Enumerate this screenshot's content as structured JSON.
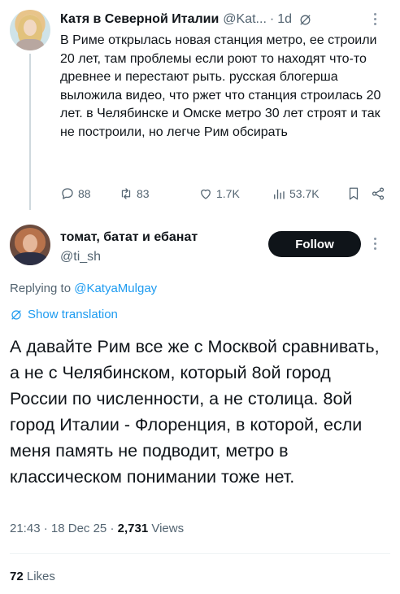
{
  "parent_tweet": {
    "author_name": "Катя в Северной Италии",
    "author_handle": "@Kat...",
    "separator": "·",
    "time": "1d",
    "text": "В Риме открылась новая станция метро, ее строили 20 лет, там проблемы если роют то находят что-то древнее и перестают рыть. русская блогерша выложила видео, что ржет что станция строилась 20 лет. в Челябинске и Омске метро 30 лет строят и так не построили, но легче Рим обсирать",
    "replies": "88",
    "retweets": "83",
    "likes": "1.7K",
    "views": "53.7K"
  },
  "main_tweet": {
    "author_name": "томат, батат и ебанат",
    "author_handle": "@ti_sh",
    "follow_label": "Follow",
    "replying_prefix": "Replying to",
    "replying_mention": "@KatyaMulgay",
    "translate_label": "Show translation",
    "text": "А давайте Рим все же с Москвой сравнивать, а не с Челябинском, который 8ой город России по численности, а не столица. 8ой город Италии - Флоренция, в которой, если меня память не подводит, метро в классическом понимании тоже нет.",
    "time": "21:43",
    "date": "18 Dec 25",
    "separator": "·",
    "views_count": "2,731",
    "views_label": "Views",
    "likes_count": "72",
    "likes_label": "Likes"
  },
  "icons": {
    "reply": "reply-icon",
    "retweet": "retweet-icon",
    "like": "like-icon",
    "views": "views-icon",
    "bookmark": "bookmark-icon",
    "share": "share-icon",
    "grok": "grok-icon",
    "more": "more-icon",
    "translate": "translate-icon"
  },
  "colors": {
    "text": "#0f1419",
    "secondary": "#536471",
    "accent": "#1d9bf0",
    "follow_bg": "#0f1419"
  }
}
